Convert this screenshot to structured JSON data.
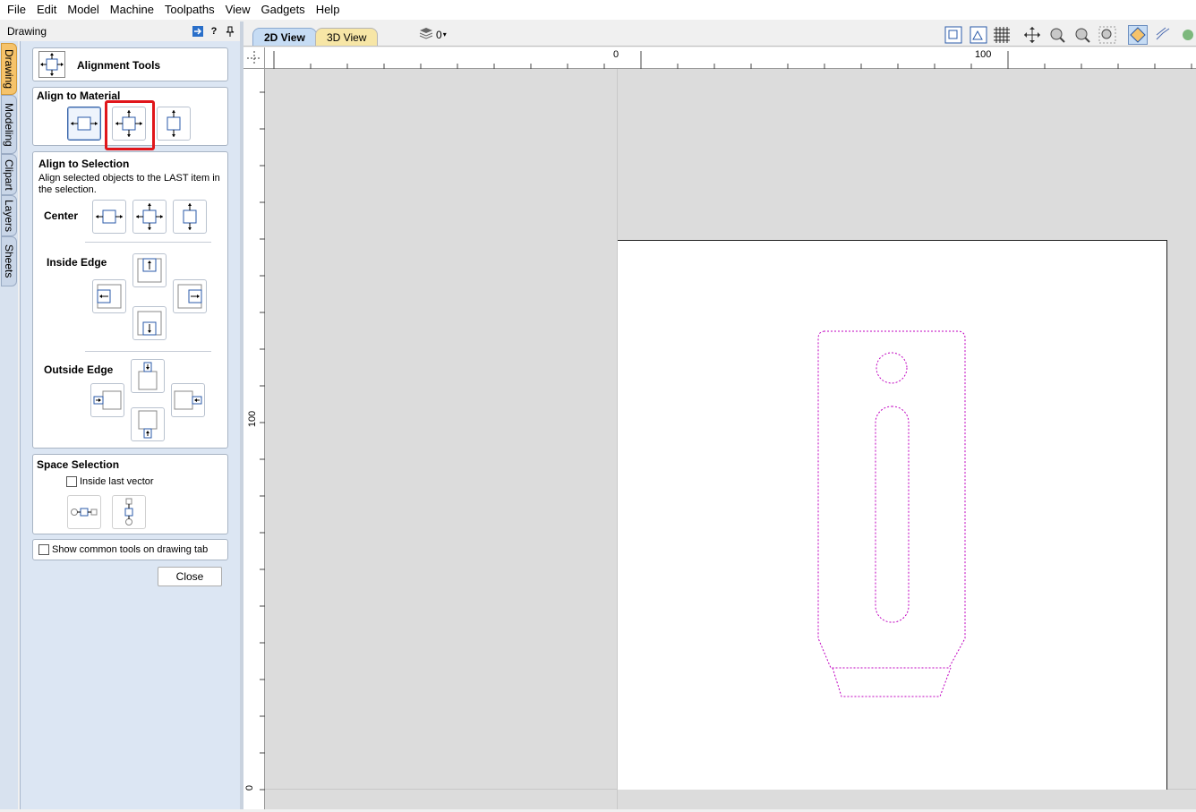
{
  "menu": [
    "File",
    "Edit",
    "Model",
    "Machine",
    "Toolpaths",
    "View",
    "Gadgets",
    "Help"
  ],
  "panel_header": {
    "title": "Drawing",
    "help": "?"
  },
  "side_tabs": [
    "Drawing",
    "Modeling",
    "Clipart",
    "Layers",
    "Sheets"
  ],
  "alignment": {
    "title": "Alignment Tools",
    "align_to_material": "Align to Material",
    "align_to_selection": "Align to Selection",
    "selection_desc": "Align selected objects to the LAST item in the selection.",
    "center": "Center",
    "inside_edge": "Inside Edge",
    "outside_edge": "Outside Edge",
    "space_selection": "Space Selection",
    "inside_last_vector": "Inside last vector",
    "show_common": "Show common tools on drawing tab",
    "close": "Close"
  },
  "view_tabs": {
    "tab2d": "2D View",
    "tab3d": "3D View",
    "layer_value": "0"
  },
  "rulers": {
    "h0": "0",
    "h100": "100",
    "v100": "100",
    "v0": "0"
  },
  "colors": {
    "vector": "#c000c0",
    "highlight": "#e0161b",
    "panel_bg": "#dce6f3",
    "active_tab": "#f6c36a"
  }
}
